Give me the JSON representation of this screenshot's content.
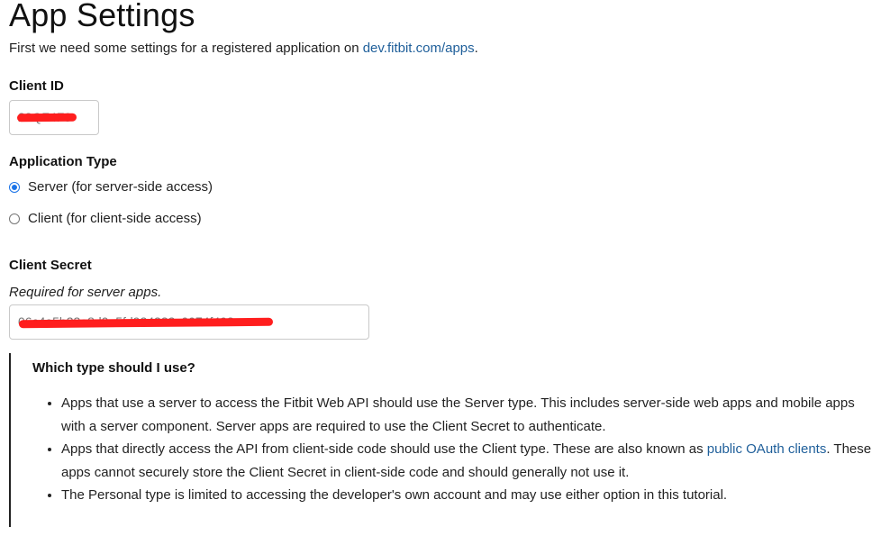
{
  "page": {
    "title": "App Settings",
    "intro_prefix": "First we need some settings for a registered application on ",
    "intro_link": "dev.fitbit.com/apps",
    "intro_suffix": "."
  },
  "client_id": {
    "label": "Client ID",
    "value": "23QZ4F9"
  },
  "application_type": {
    "label": "Application Type",
    "options": [
      {
        "label": "Server (for server-side access)",
        "selected": true
      },
      {
        "label": "Client (for client-side access)",
        "selected": false
      }
    ]
  },
  "client_secret": {
    "label": "Client Secret",
    "help": "Required for server apps.",
    "value": "06c4a5b23a8d0a5fd924333c0074f498"
  },
  "guide": {
    "heading": "Which type should I use?",
    "item1": "Apps that use a server to access the Fitbit Web API should use the Server type. This includes server-side web apps and mobile apps with a server component. Server apps are required to use the Client Secret to authenticate.",
    "item2_prefix": "Apps that directly access the API from client-side code should use the Client type. These are also known as ",
    "item2_link": "public OAuth clients",
    "item2_suffix": ". These apps cannot securely store the Client Secret in client-side code and should generally not use it.",
    "item3": "The Personal type is limited to accessing the developer's own account and may use either option in this tutorial."
  },
  "colors": {
    "link": "#1f5f9a",
    "radio_selected": "#1a73e8",
    "redaction": "#ff1e1e"
  }
}
